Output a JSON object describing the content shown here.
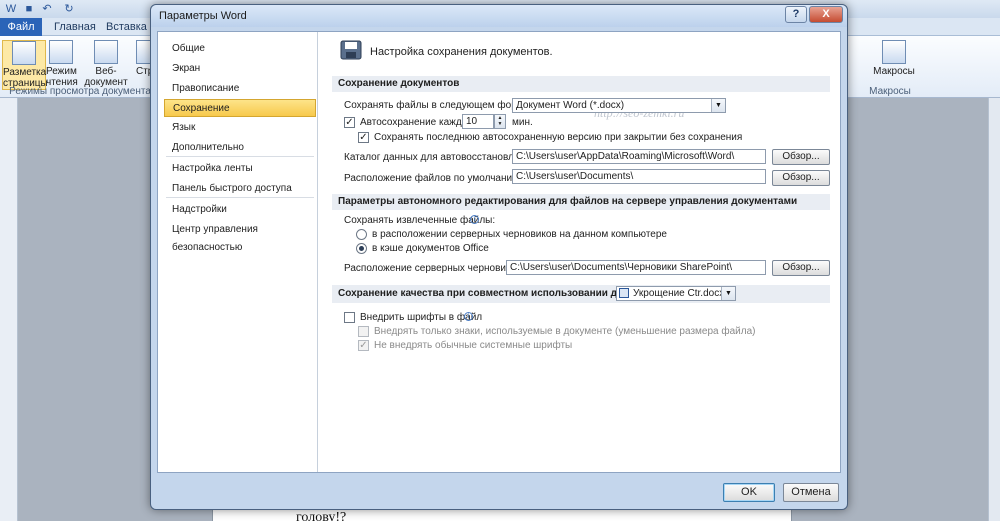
{
  "word": {
    "tabs": [
      "Файл",
      "Главная",
      "Вставка"
    ],
    "ribbon_buttons": [
      {
        "label": "Разметка страницы"
      },
      {
        "label": "Режим чтения"
      },
      {
        "label": "Веб-документ"
      },
      {
        "label": "Стр"
      }
    ],
    "ribbon_group_label": "Режимы просмотра документа",
    "macros_label": "Макросы",
    "macros_group_label": "Макросы",
    "page_text": "голову!?"
  },
  "dialog": {
    "title": "Параметры Word",
    "help_glyph": "?",
    "close_glyph": "X",
    "nav": [
      {
        "label": "Общие"
      },
      {
        "label": "Экран"
      },
      {
        "label": "Правописание"
      },
      {
        "label": "Сохранение"
      },
      {
        "label": "Язык"
      },
      {
        "label": "Дополнительно"
      },
      {
        "label": "Настройка ленты"
      },
      {
        "label": "Панель быстрого доступа"
      },
      {
        "label": "Надстройки"
      },
      {
        "label": "Центр управления безопасностью"
      }
    ],
    "active_nav": "Сохранение",
    "content_title": "Настройка сохранения документов.",
    "watermark": "http://seo-zemki.ru",
    "section1": {
      "header": "Сохранение документов",
      "format_label": "Сохранять файлы в следующем формате:",
      "format_value": "Документ Word (*.docx)",
      "autosave_label": "Автосохранение каждые",
      "autosave_value": "10",
      "autosave_unit": "мин.",
      "keep_last_label": "Сохранять последнюю автосохраненную версию при закрытии без сохранения",
      "autorecover_label": "Каталог данных для автовосстановления:",
      "autorecover_path": "C:\\Users\\user\\AppData\\Roaming\\Microsoft\\Word\\",
      "default_location_label": "Расположение файлов по умолчанию:",
      "default_location_path": "C:\\Users\\user\\Documents\\",
      "browse_label": "Обзор..."
    },
    "section2": {
      "header": "Параметры автономного редактирования для файлов на сервере управления документами",
      "save_checked_label": "Сохранять извлеченные файлы:",
      "radio1_label": "в расположении серверных черновиков на данном компьютере",
      "radio2_label": "в кэше документов Office",
      "drafts_label": "Расположение серверных черновиков:",
      "drafts_path": "C:\\Users\\user\\Documents\\Черновики SharePoint\\",
      "browse_label": "Обзор..."
    },
    "section3": {
      "header": "Сохранение качества при совместном использовании документа:",
      "doc_value": "Укрощение Ctr.docx",
      "embed_fonts_label": "Внедрить шрифты в файл",
      "embed_only_used_label": "Внедрять только знаки, используемые в документе (уменьшение размера файла)",
      "no_common_fonts_label": "Не внедрять обычные системные шрифты"
    },
    "ok_label": "OK",
    "cancel_label": "Отмена"
  }
}
